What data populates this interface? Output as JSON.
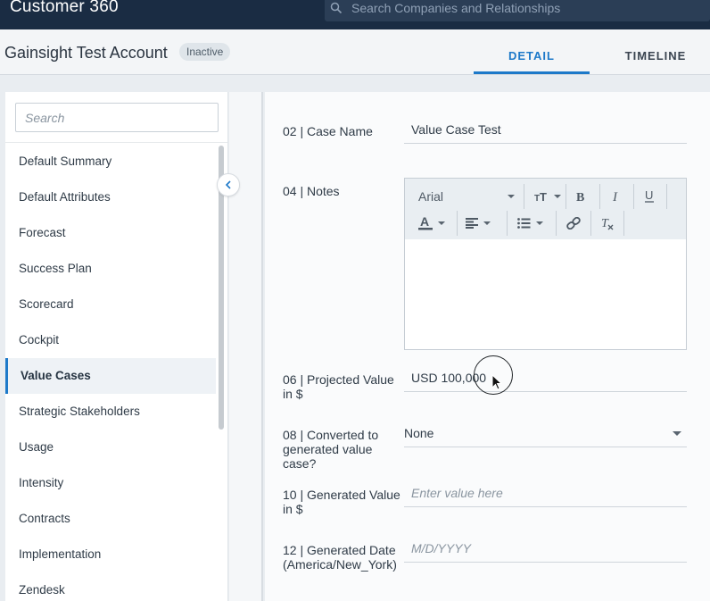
{
  "topbar": {
    "app_title": "Customer 360",
    "search_placeholder": "Search Companies and Relationships"
  },
  "header": {
    "account_name": "Gainsight Test Account",
    "status": "Inactive",
    "tabs": [
      {
        "label": "DETAIL",
        "active": true
      },
      {
        "label": "TIMELINE",
        "active": false
      }
    ]
  },
  "sidebar": {
    "search_placeholder": "Search",
    "items": [
      {
        "label": "Default Summary"
      },
      {
        "label": "Default Attributes"
      },
      {
        "label": "Forecast"
      },
      {
        "label": "Success Plan"
      },
      {
        "label": "Scorecard"
      },
      {
        "label": "Cockpit"
      },
      {
        "label": "Value Cases",
        "active": true
      },
      {
        "label": "Strategic Stakeholders"
      },
      {
        "label": "Usage"
      },
      {
        "label": "Intensity"
      },
      {
        "label": "Contracts"
      },
      {
        "label": "Implementation"
      },
      {
        "label": "Zendesk"
      }
    ]
  },
  "form": {
    "case_name": {
      "label": "02 | Case Name",
      "value": "Value Case Test"
    },
    "notes": {
      "label": "04 | Notes",
      "font": "Arial"
    },
    "projected_value": {
      "label": "06 | Projected Value in $",
      "value": "USD 100,000"
    },
    "converted": {
      "label": "08 | Converted to generated value case?",
      "value": "None"
    },
    "generated_value": {
      "label": "10 | Generated Value in $",
      "placeholder": "Enter value here"
    },
    "generated_date": {
      "label": "12 | Generated Date (America/New_York)",
      "placeholder": "M/D/YYYY"
    }
  },
  "colors": {
    "accent": "#1d79c9",
    "topbar": "#1a2c43"
  }
}
